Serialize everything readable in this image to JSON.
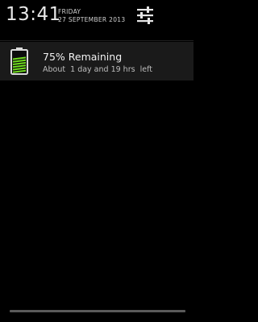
{
  "status_header": {
    "time": "13:41",
    "day": "FRIDAY",
    "date": "27 SEPTEMBER 2013",
    "settings_icon": "sliders-icon"
  },
  "notification": {
    "icon": "battery-icon",
    "title": "75% Remaining",
    "text": "About  1 day and 19 hrs  left",
    "battery_level": 0.75,
    "battery_color": "#6fdc1f"
  }
}
